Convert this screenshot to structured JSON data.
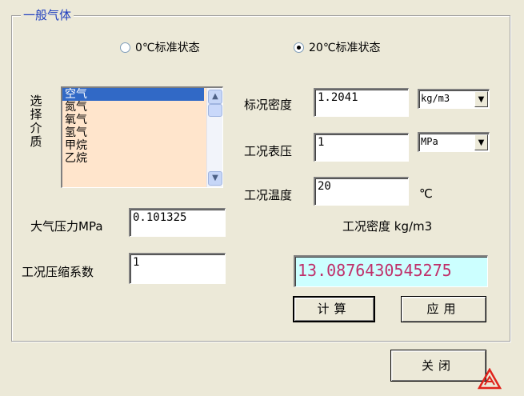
{
  "group": {
    "title": "一般气体"
  },
  "state_options": {
    "opt0": {
      "label": "0℃标准状态",
      "selected": false
    },
    "opt20": {
      "label": "20℃标准状态",
      "selected": true
    }
  },
  "medium": {
    "label": "选择介质",
    "items": [
      "空气",
      "氮气",
      "氧气",
      "氢气",
      "甲烷",
      "乙烷"
    ],
    "selected_index": 0
  },
  "std_density": {
    "label": "标况密度",
    "value": "1.2041",
    "unit": "kg/m3"
  },
  "gauge_pressure": {
    "label": "工况表压",
    "value": "1",
    "unit": "MPa"
  },
  "work_temperature": {
    "label": "工况温度",
    "value": "20",
    "unit": "℃"
  },
  "atm_pressure": {
    "label": "大气压力MPa",
    "value": "0.101325"
  },
  "compress_factor": {
    "label": "工况压缩系数",
    "value": "1"
  },
  "work_density": {
    "label": "工况密度 kg/m3",
    "value": "13.0876430545275"
  },
  "buttons": {
    "calc": "计算",
    "apply": "应用",
    "close": "关闭"
  },
  "colors": {
    "result_bg": "#ccffff",
    "result_text": "#c0306a",
    "title": "#1f3fbf",
    "logo": "#e0231c"
  },
  "icons": {
    "logo": "logo-icon"
  }
}
